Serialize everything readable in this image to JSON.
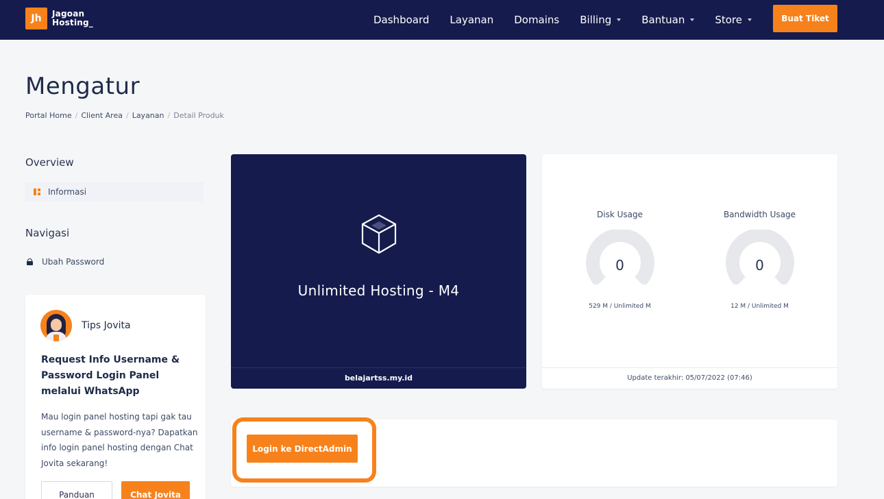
{
  "navbar": {
    "logo_mark": "Jh",
    "logo_line1": "Jagoan",
    "logo_line2": "Hosting_",
    "links": [
      {
        "label": "Dashboard",
        "dropdown": false
      },
      {
        "label": "Layanan",
        "dropdown": false
      },
      {
        "label": "Domains",
        "dropdown": false
      },
      {
        "label": "Billing",
        "dropdown": true
      },
      {
        "label": "Bantuan",
        "dropdown": true
      },
      {
        "label": "Store",
        "dropdown": true
      }
    ],
    "cta_label": "Buat Tiket"
  },
  "page": {
    "title": "Mengatur",
    "breadcrumb": [
      "Portal Home",
      "Client Area",
      "Layanan",
      "Detail Produk"
    ]
  },
  "sidebar": {
    "overview_heading": "Overview",
    "overview_item": "Informasi",
    "nav_heading": "Navigasi",
    "nav_item": "Ubah Password",
    "tips": {
      "title": "Tips Jovita",
      "headline": "Request Info Username & Password Login Panel melalui WhatsApp",
      "body": "Mau login panel hosting tapi gak tau username & password-nya? Dapatkan info login panel hosting dengan Chat Jovita sekarang!",
      "btn_guide": "Panduan",
      "btn_chat": "Chat Jovita"
    }
  },
  "product": {
    "name": "Unlimited Hosting - M4",
    "domain": "belajartss.my.id"
  },
  "usage": {
    "disk": {
      "label": "Disk Usage",
      "value": "0",
      "sub": "529 M / Unlimited M",
      "fraction": 0
    },
    "bandwidth": {
      "label": "Bandwidth Usage",
      "value": "0",
      "sub": "12 M / Unlimited M",
      "fraction": 0
    },
    "updated": "Update terakhir: 05/07/2022 (07:46)"
  },
  "login": {
    "button_label": "Login ke DirectAdmin"
  },
  "colors": {
    "navy": "#151b4d",
    "accent": "#f7821b",
    "gauge_track": "#e7e8ec"
  }
}
